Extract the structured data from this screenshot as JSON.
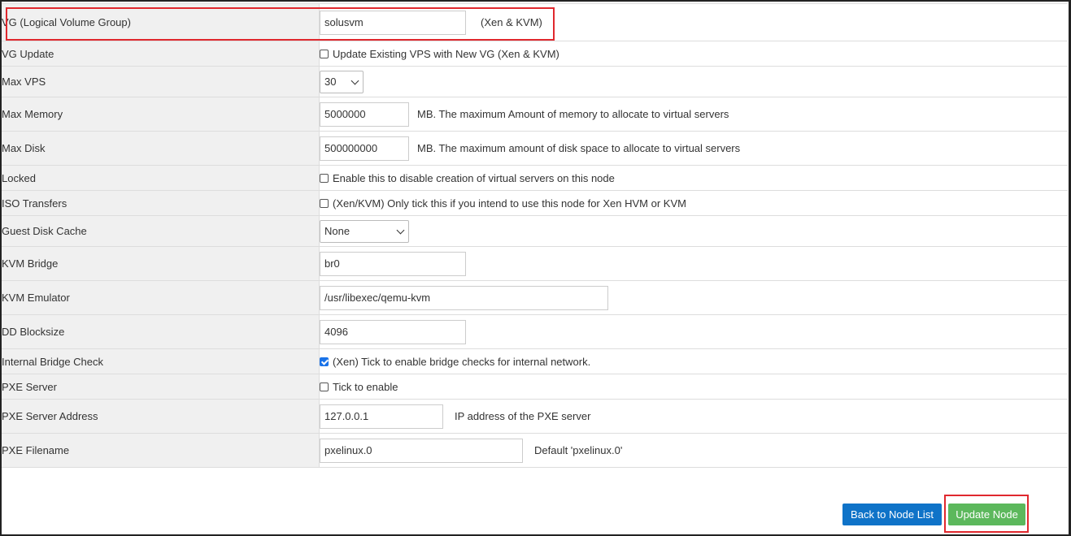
{
  "rows": [
    {
      "label": "VG (Logical Volume Group)",
      "value": "solusvm",
      "hint": "(Xen & KVM)"
    },
    {
      "label": "VG Update",
      "checkbox_label": "Update Existing VPS with New VG (Xen & KVM)",
      "checked": false
    },
    {
      "label": "Max VPS",
      "selected": "30"
    },
    {
      "label": "Max Memory",
      "value": "5000000",
      "hint": "MB. The maximum Amount of memory to allocate to virtual servers"
    },
    {
      "label": "Max Disk",
      "value": "500000000",
      "hint": "MB. The maximum amount of disk space to allocate to virtual servers"
    },
    {
      "label": "Locked",
      "checkbox_label": " Enable this to disable creation of virtual servers on this node",
      "checked": false
    },
    {
      "label": "ISO Transfers",
      "checkbox_label": "(Xen/KVM) Only tick this if you intend to use this node for Xen HVM or KVM",
      "checked": false
    },
    {
      "label": "Guest Disk Cache",
      "selected": "None"
    },
    {
      "label": "KVM Bridge",
      "value": "br0"
    },
    {
      "label": "KVM Emulator",
      "value": "/usr/libexec/qemu-kvm"
    },
    {
      "label": "DD Blocksize",
      "value": "4096"
    },
    {
      "label": "Internal Bridge Check",
      "checkbox_label": "(Xen) Tick to enable bridge checks for internal network.",
      "checked": true
    },
    {
      "label": "PXE Server",
      "checkbox_label": "Tick to enable",
      "checked": false
    },
    {
      "label": "PXE Server Address",
      "value": "127.0.0.1",
      "hint": "IP address of the PXE server"
    },
    {
      "label": "PXE Filename",
      "value": "pxelinux.0",
      "hint": "Default 'pxelinux.0'"
    }
  ],
  "buttons": {
    "back": "Back to Node List",
    "update": "Update Node"
  },
  "colors": {
    "highlight": "#e0282e",
    "back_button": "#0f73c8",
    "update_button": "#5cb85c",
    "label_bg": "#f0f0f0"
  }
}
